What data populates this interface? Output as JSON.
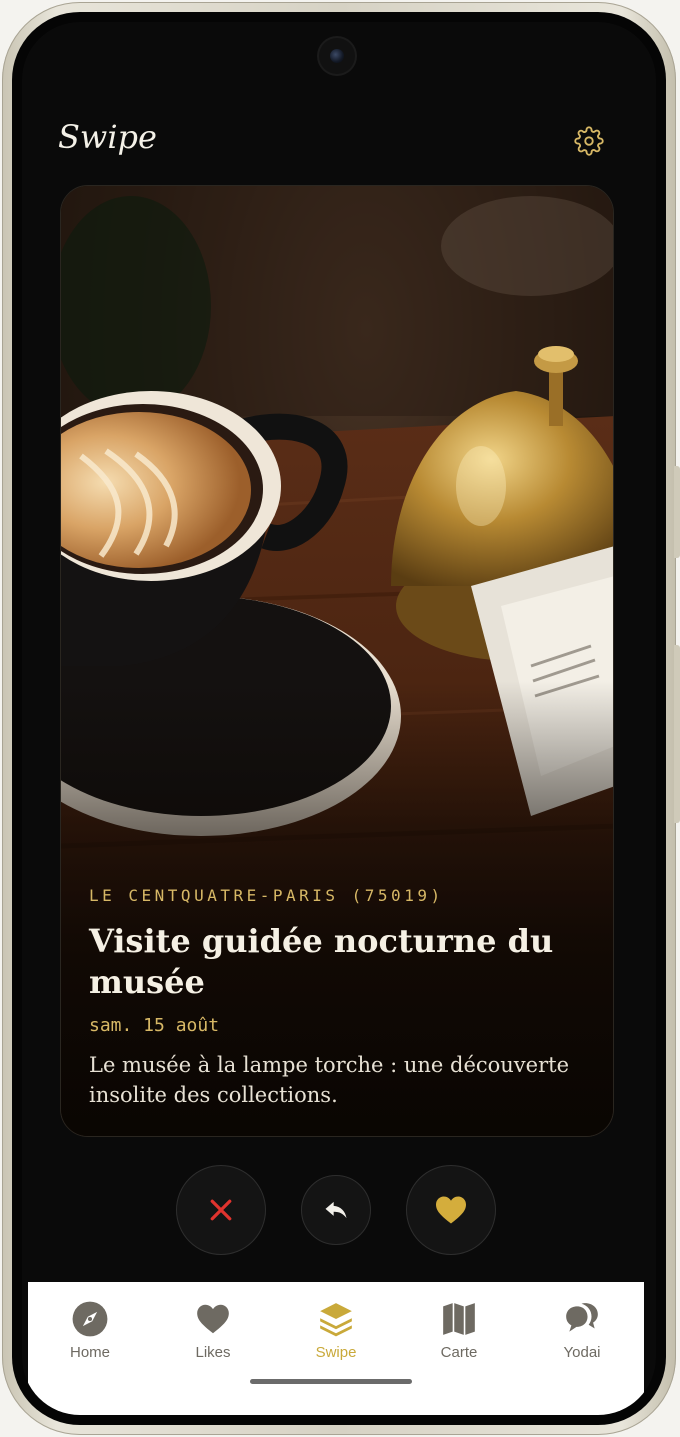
{
  "header": {
    "title": "Swipe",
    "settings_icon": "gear-icon"
  },
  "card": {
    "image_subject": "latte coffee cup and brass service bell on wooden bar",
    "venue": "LE CENTQUATRE-PARIS (75019)",
    "title": "Visite guidée nocturne du musée",
    "date": "sam. 15 août",
    "description": "Le musée à la lampe torche : une découverte insolite des collections."
  },
  "actions": {
    "reject_icon": "close-icon",
    "undo_icon": "undo-icon",
    "like_icon": "heart-icon"
  },
  "nav": {
    "items": [
      {
        "label": "Home",
        "icon": "compass-icon",
        "active": false
      },
      {
        "label": "Likes",
        "icon": "heart-icon",
        "active": false
      },
      {
        "label": "Swipe",
        "icon": "layers-icon",
        "active": true
      },
      {
        "label": "Carte",
        "icon": "map-icon",
        "active": false
      },
      {
        "label": "Yodai",
        "icon": "chat-icon",
        "active": false
      }
    ]
  },
  "colors": {
    "accent": "#d7b866",
    "active_nav": "#c9a93a",
    "reject": "#e0332e",
    "like": "#d4ad3c",
    "background": "#0a0a0a"
  }
}
